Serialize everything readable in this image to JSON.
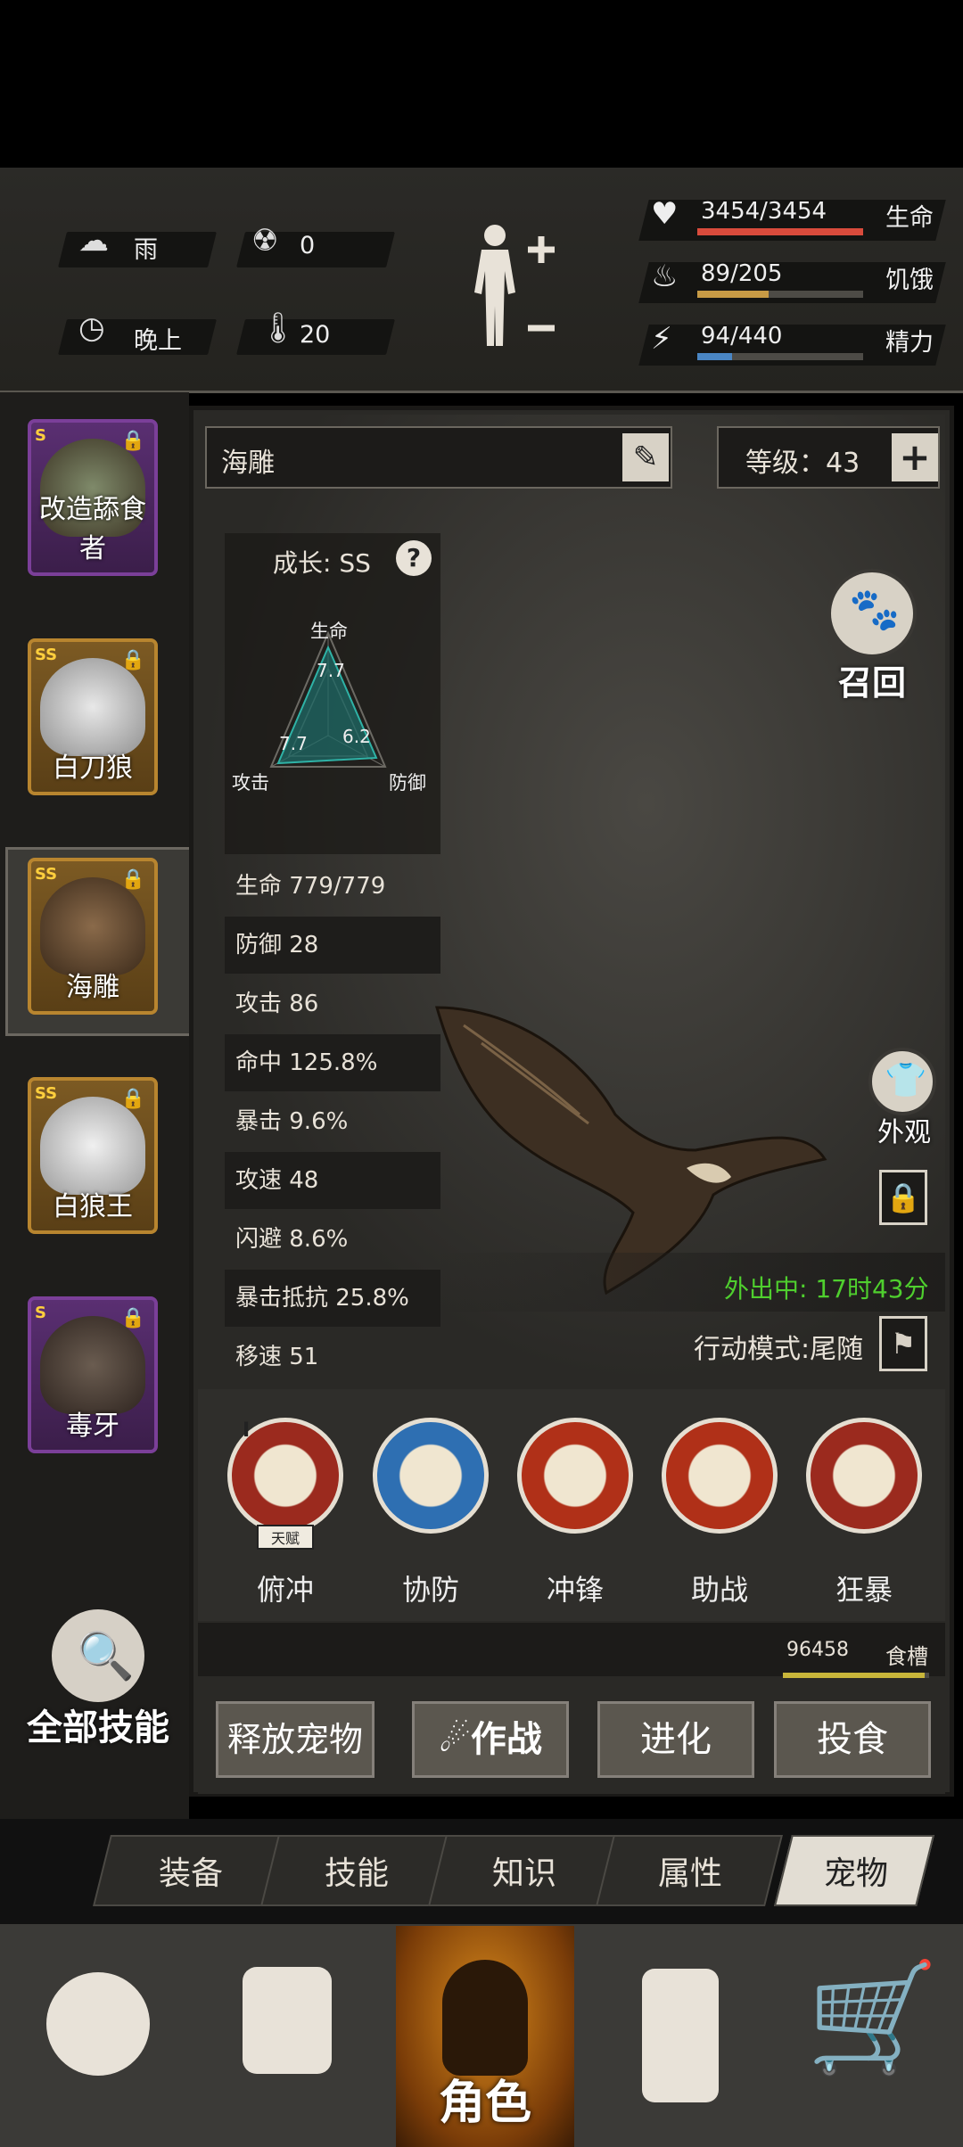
{
  "status": {
    "weather": "雨",
    "radiation": "0",
    "time_of_day": "晚上",
    "temperature": "20",
    "health_value": "3454/3454",
    "health_label": "生命",
    "health_fraction": 1.0,
    "hunger_value": "89/205",
    "hunger_label": "饥饿",
    "hunger_fraction": 0.43,
    "energy_value": "94/440",
    "energy_label": "精力",
    "energy_fraction": 0.21,
    "colors": {
      "health": "#d94b3c",
      "hunger": "#c79a45",
      "energy": "#4a86c4"
    }
  },
  "pets": [
    {
      "name": "改造舔食者",
      "rank": "S",
      "frame": "purple"
    },
    {
      "name": "白刀狼",
      "rank": "SS",
      "frame": "gold"
    },
    {
      "name": "海雕",
      "rank": "SS",
      "frame": "gold",
      "selected": true
    },
    {
      "name": "白狼王",
      "rank": "SS",
      "frame": "gold"
    },
    {
      "name": "毒牙",
      "rank": "S",
      "frame": "purple"
    }
  ],
  "all_skills_label": "全部技能",
  "pet_detail": {
    "name": "海雕",
    "level_label": "等级：43",
    "growth_label": "成长: SS",
    "radar": {
      "top_label": "生命",
      "left_label": "攻击",
      "right_label": "防御",
      "top_value": "7.7",
      "left_value": "7.7",
      "right_value": "6.2"
    },
    "stats": [
      "生命 779/779",
      "防御 28",
      "攻击 86",
      "命中 125.8%",
      "暴击 9.6%",
      "攻速 48",
      "闪避 8.6%",
      "暴击抵抗 25.8%",
      "移速 51"
    ],
    "recall_label": "召回",
    "appearance_label": "外观",
    "status_text": "外出中:  17时43分",
    "mode_text": "行动模式:尾随",
    "talent_badge": "天赋",
    "talent_rank": "I",
    "skills": [
      "俯冲",
      "协防",
      "冲锋",
      "助战",
      "狂暴"
    ],
    "food_value": "96458",
    "food_label": "食槽",
    "food_fraction": 0.97
  },
  "actions": {
    "release": "释放宠物",
    "battle": "作战",
    "evolve": "进化",
    "feed": "投食"
  },
  "tabs": [
    "装备",
    "技能",
    "知识",
    "属性",
    "宠物"
  ],
  "active_tab": "宠物",
  "nav": {
    "character_label": "角色"
  }
}
